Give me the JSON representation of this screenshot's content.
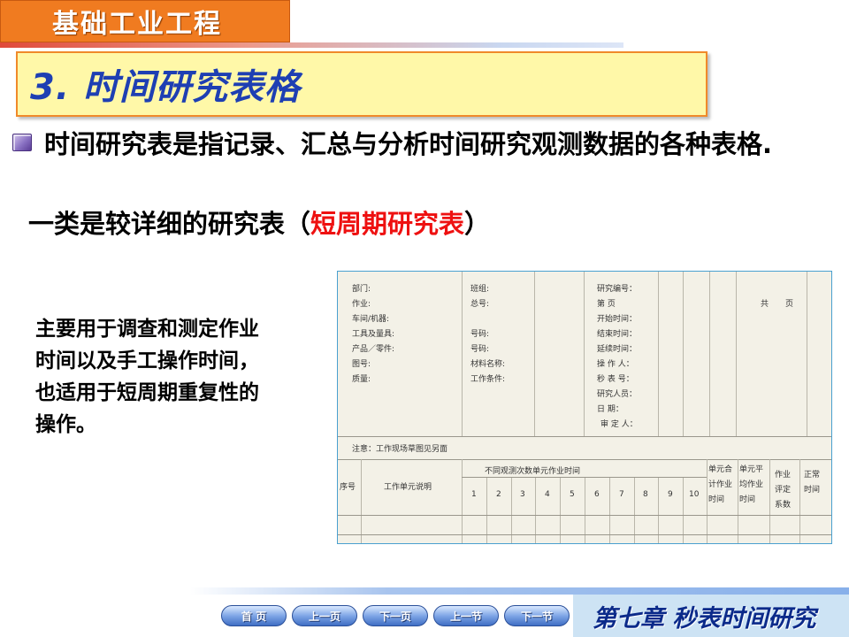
{
  "header": {
    "course_title": "基础工业工程",
    "section_title": "3. 时间研究表格"
  },
  "content": {
    "bullet_text": "时间研究表是指记录、汇总与分析时间研究观测数据的各种表格.",
    "second_line_prefix": "一类是较详细的研究表（",
    "second_line_red": "短周期研究表",
    "second_line_suffix": "）",
    "side_text": "主要用于调查和测定作业时间以及手工操作时间，也适用于短周期重复性的操作。"
  },
  "form": {
    "left_labels": [
      "部门:",
      "作业:",
      "车间/机器:",
      "工具及量具:",
      "产品／零件:",
      "图号:",
      "质量:"
    ],
    "mid_labels": [
      "班组:",
      "总号:",
      "",
      "号码:",
      "号码:",
      "材料名称:",
      "工作条件:"
    ],
    "right_labels": [
      "研究编号：",
      "第    页",
      "开始时间：",
      "结束时间：",
      "延续时间：",
      "操 作 人：",
      "秒 表 号：",
      "研究人员：",
      "日   期：",
      "审 定 人："
    ],
    "gong": "共",
    "ye": "页",
    "note": "注意：工作现场草图见另面",
    "col_seq": "序号",
    "col_desc": "工作单元说明",
    "col_group": "不同观测次数单元作业时间",
    "col_nums": [
      "1",
      "2",
      "3",
      "4",
      "5",
      "6",
      "7",
      "8",
      "9",
      "10"
    ],
    "col_sum": "单元合计作业时间",
    "col_avg": "单元平均作业时间",
    "col_rate": "作业评定系数",
    "col_normal": "正常时间"
  },
  "nav": {
    "buttons": [
      "首  页",
      "上一页",
      "下一页",
      "上一节",
      "下一节"
    ],
    "chapter": "第七章 秒表时间研究"
  }
}
